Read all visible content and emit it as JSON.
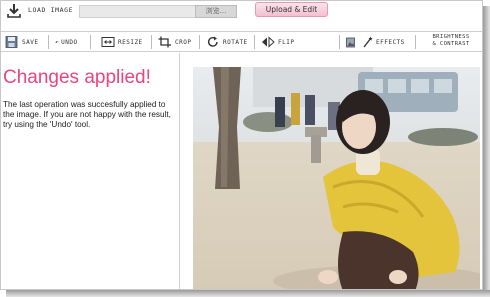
{
  "load": {
    "label": "LOAD IMAGE",
    "browse_label": "浏览..."
  },
  "upload_button": "Upload & Edit",
  "toolbar": {
    "save": "SAVE",
    "undo": "UNDO",
    "resize": "RESIZE",
    "crop": "CROP",
    "rotate": "ROTATE",
    "flip": "FLIP",
    "effects": "EFFECTS",
    "brightness_line1": "BRIGHTNESS",
    "brightness_line2": "& CONTRAST"
  },
  "message": {
    "title": "Changes applied!",
    "body": "The last operation was succesfully applied to the image. If you are not happy with the result, try using the 'Undo' tool."
  },
  "colors": {
    "accent": "#e8467c",
    "upload_button_bg": "#f5bfd0"
  }
}
